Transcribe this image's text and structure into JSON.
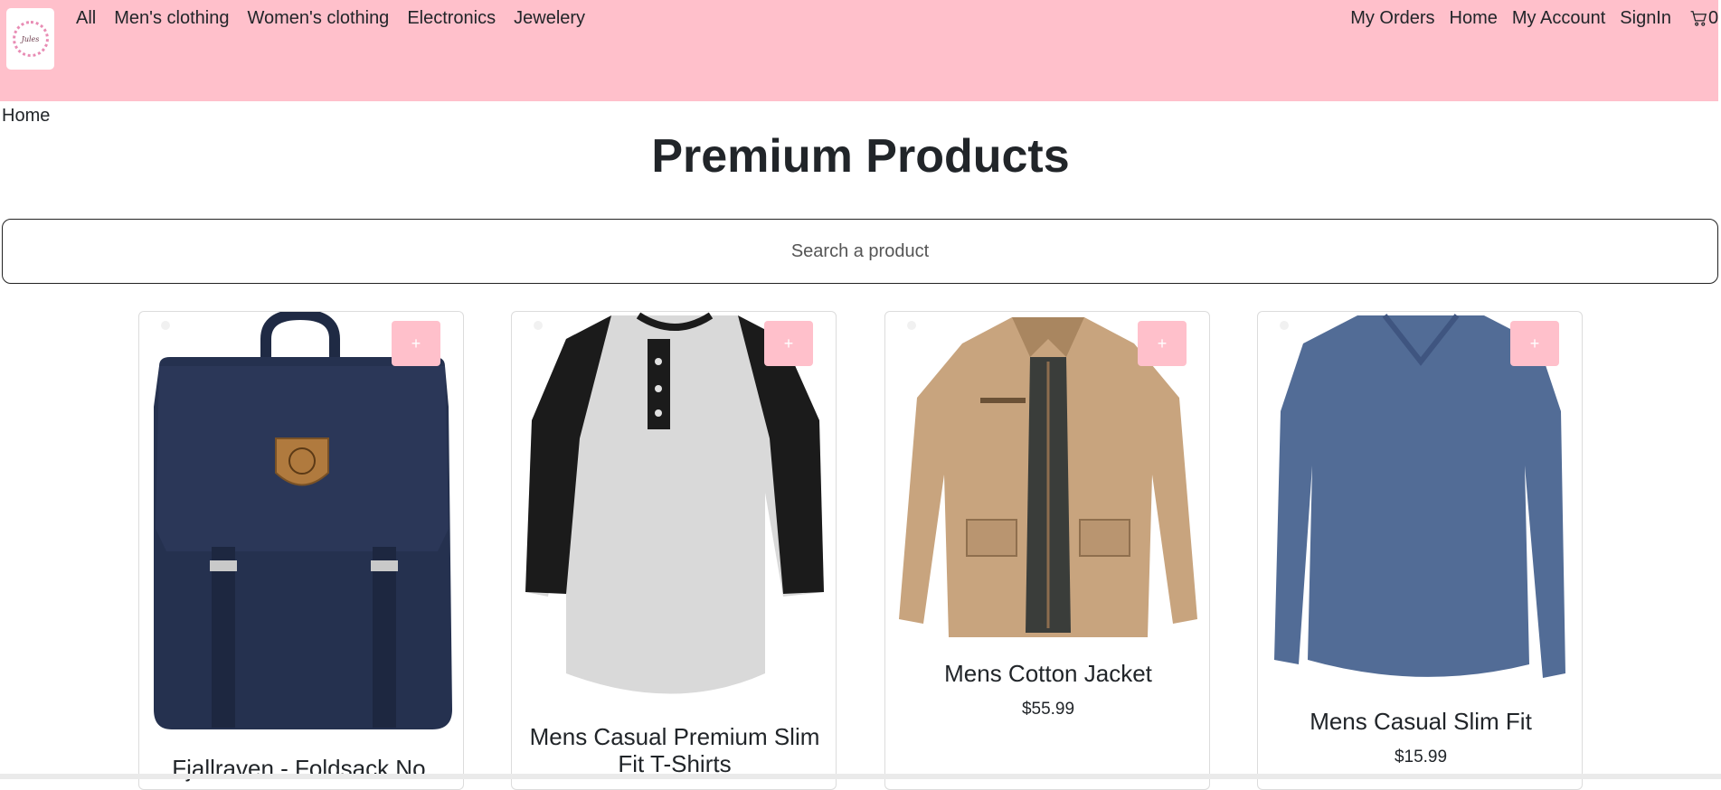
{
  "brand": {
    "logo_text": "Jules"
  },
  "nav": {
    "left": [
      "All",
      "Men's clothing",
      "Women's clothing",
      "Electronics",
      "Jewelery"
    ],
    "right": [
      "My Orders",
      "Home",
      "My Account",
      "SignIn"
    ],
    "cart_count": "0"
  },
  "breadcrumb": "Home",
  "page_title": "Premium Products",
  "search": {
    "placeholder": "Search a product",
    "value": ""
  },
  "products": [
    {
      "title": "Fjallraven - Foldsack No.",
      "price": "",
      "add_label": "+",
      "image": "navy-backpack"
    },
    {
      "title": "Mens Casual Premium Slim Fit T-Shirts",
      "price": "",
      "add_label": "+",
      "image": "raglan-henley-tshirt"
    },
    {
      "title": "Mens Cotton Jacket",
      "price": "$55.99",
      "add_label": "+",
      "image": "khaki-cotton-jacket"
    },
    {
      "title": "Mens Casual Slim Fit",
      "price": "$15.99",
      "add_label": "+",
      "image": "blue-longsleeve-shirt"
    }
  ],
  "colors": {
    "navbar": "#ffc0cb",
    "add_button": "#ffc0cb"
  }
}
